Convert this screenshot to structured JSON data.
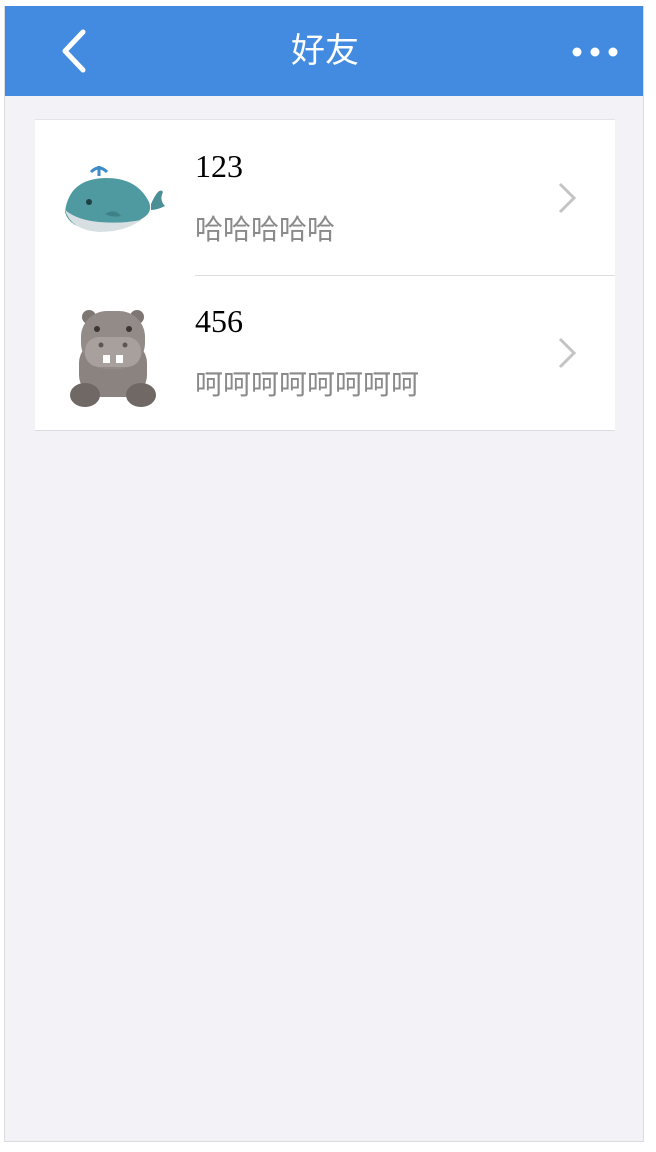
{
  "navbar": {
    "title": "好友",
    "background_color": "#428be0",
    "back_icon": "chevron-left-icon",
    "more_icon": "ellipsis-icon"
  },
  "friends": [
    {
      "name": "123",
      "message": "哈哈哈哈哈",
      "avatar": "whale-avatar"
    },
    {
      "name": "456",
      "message": "呵呵呵呵呵呵呵呵",
      "avatar": "hippo-avatar"
    }
  ],
  "row_arrow_icon": "chevron-right-icon"
}
